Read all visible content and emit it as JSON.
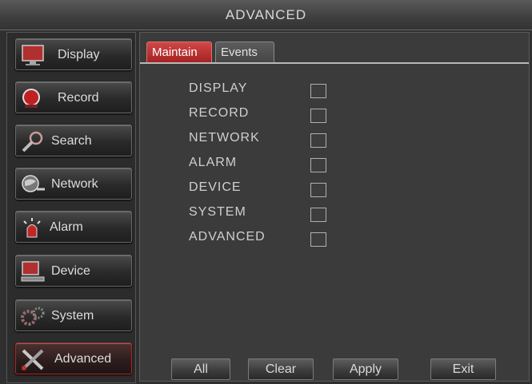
{
  "title": "ADVANCED",
  "menu": [
    {
      "label": "Display",
      "icon": "monitor-icon"
    },
    {
      "label": "Record",
      "icon": "record-icon"
    },
    {
      "label": "Search",
      "icon": "magnifier-icon"
    },
    {
      "label": "Network",
      "icon": "network-globe-icon"
    },
    {
      "label": "Alarm",
      "icon": "alarm-siren-icon"
    },
    {
      "label": "Device",
      "icon": "device-icon"
    },
    {
      "label": "System",
      "icon": "gears-icon"
    },
    {
      "label": "Advanced",
      "icon": "tools-icon"
    }
  ],
  "active_menu": "Advanced",
  "tabs": [
    {
      "label": "Maintain",
      "active": true
    },
    {
      "label": "Events",
      "active": false
    }
  ],
  "options": [
    {
      "label": "DISPLAY",
      "checked": false
    },
    {
      "label": "RECORD",
      "checked": false
    },
    {
      "label": "NETWORK",
      "checked": false
    },
    {
      "label": "ALARM",
      "checked": false
    },
    {
      "label": "DEVICE",
      "checked": false
    },
    {
      "label": "SYSTEM",
      "checked": false
    },
    {
      "label": "ADVANCED",
      "checked": false
    }
  ],
  "buttons": {
    "all": "All",
    "clear": "Clear",
    "apply": "Apply",
    "exit": "Exit"
  },
  "colors": {
    "accent_red": "#c83232",
    "panel": "#3b3b3b",
    "text": "#cfcfcf"
  }
}
